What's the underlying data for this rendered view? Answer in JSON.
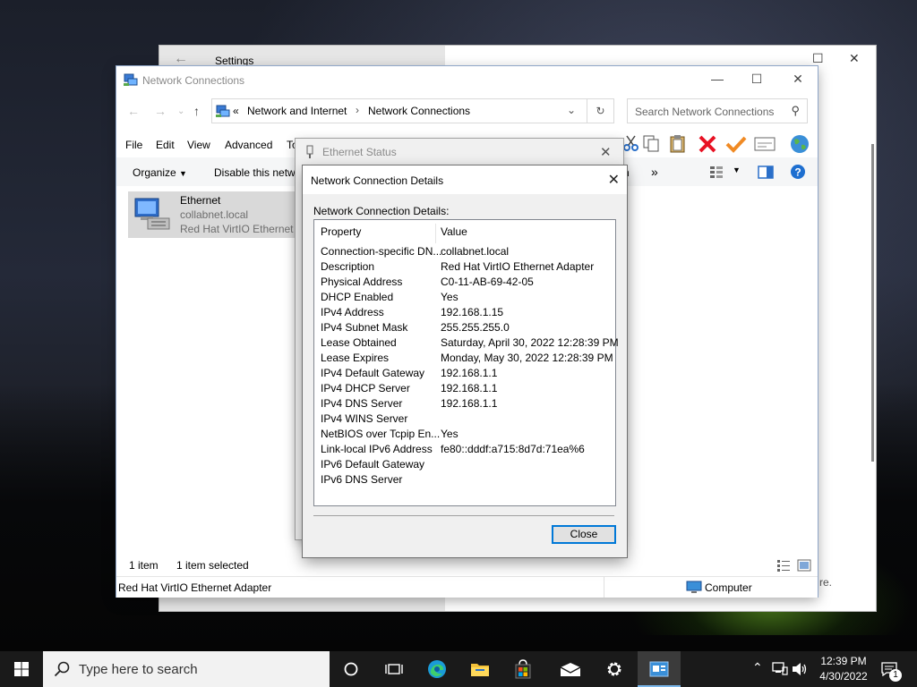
{
  "settings": {
    "title": "Settings",
    "snippet": "re."
  },
  "net_window": {
    "title": "Network Connections",
    "breadcrumb": [
      "«",
      "Network and Internet",
      "Network Connections"
    ],
    "search_placeholder": "Search Network Connections",
    "menu": [
      "File",
      "Edit",
      "View",
      "Advanced",
      "To"
    ],
    "commands": {
      "organize": "Organize",
      "disable": "Disable this netwo",
      "partial": "h",
      "more": "»"
    },
    "item": {
      "name": "Ethernet",
      "network": "collabnet.local",
      "adapter": "Red Hat VirtIO Ethernet A"
    },
    "status": {
      "count": "1 item",
      "selected": "1 item selected",
      "adapter": "Red Hat VirtIO Ethernet Adapter",
      "computer": "Computer"
    }
  },
  "eth_status": {
    "title": "Ethernet Status"
  },
  "details": {
    "title": "Network Connection Details",
    "label": "Network Connection Details:",
    "columns": [
      "Property",
      "Value"
    ],
    "rows": [
      {
        "property": "Connection-specific DN...",
        "value": "collabnet.local"
      },
      {
        "property": "Description",
        "value": "Red Hat VirtIO Ethernet Adapter"
      },
      {
        "property": "Physical Address",
        "value": "C0-11-AB-69-42-05"
      },
      {
        "property": "DHCP Enabled",
        "value": "Yes"
      },
      {
        "property": "IPv4 Address",
        "value": "192.168.1.15"
      },
      {
        "property": "IPv4 Subnet Mask",
        "value": "255.255.255.0"
      },
      {
        "property": "Lease Obtained",
        "value": "Saturday, April 30, 2022 12:28:39 PM"
      },
      {
        "property": "Lease Expires",
        "value": "Monday, May 30, 2022 12:28:39 PM"
      },
      {
        "property": "IPv4 Default Gateway",
        "value": "192.168.1.1"
      },
      {
        "property": "IPv4 DHCP Server",
        "value": "192.168.1.1"
      },
      {
        "property": "IPv4 DNS Server",
        "value": "192.168.1.1"
      },
      {
        "property": "IPv4 WINS Server",
        "value": ""
      },
      {
        "property": "NetBIOS over Tcpip En...",
        "value": "Yes"
      },
      {
        "property": "Link-local IPv6 Address",
        "value": "fe80::dddf:a715:8d7d:71ea%6"
      },
      {
        "property": "IPv6 Default Gateway",
        "value": ""
      },
      {
        "property": "IPv6 DNS Server",
        "value": ""
      }
    ],
    "close_label": "Close"
  },
  "taskbar": {
    "search_placeholder": "Type here to search",
    "time": "12:39 PM",
    "date": "4/30/2022",
    "notification_count": "1",
    "icons": [
      "task-view-icon",
      "edge-icon",
      "file-explorer-icon",
      "store-icon",
      "mail-icon",
      "settings-icon",
      "network-connections-icon"
    ]
  },
  "colors": {
    "accent": "#0078d7",
    "delete_red": "#e81123",
    "check_orange": "#f08a24",
    "taskbar": "#1a1a1a"
  }
}
